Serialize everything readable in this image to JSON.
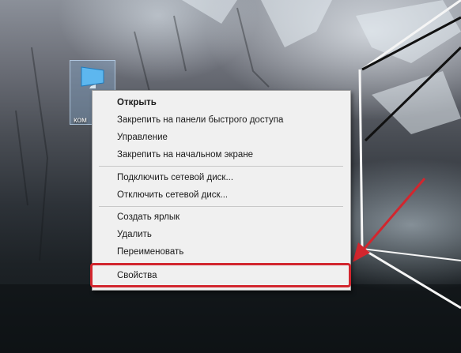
{
  "desktop": {
    "icon": {
      "name": "computer-icon",
      "label": "ком"
    }
  },
  "context_menu": {
    "items": [
      {
        "label": "Открыть",
        "bold": true
      },
      {
        "label": "Закрепить на панели быстрого доступа"
      },
      {
        "label": "Управление"
      },
      {
        "label": "Закрепить на начальном экране"
      },
      {
        "label": "Подключить сетевой диск..."
      },
      {
        "label": "Отключить сетевой диск..."
      },
      {
        "label": "Создать ярлык"
      },
      {
        "label": "Удалить"
      },
      {
        "label": "Переименовать"
      },
      {
        "label": "Свойства"
      }
    ]
  },
  "annotation": {
    "highlight_color": "#d2262e",
    "arrow_color": "#d2262e",
    "target_item": "Свойства"
  },
  "colors": {
    "menu_background": "#f0f0f0",
    "menu_border": "#a0a0a0"
  }
}
